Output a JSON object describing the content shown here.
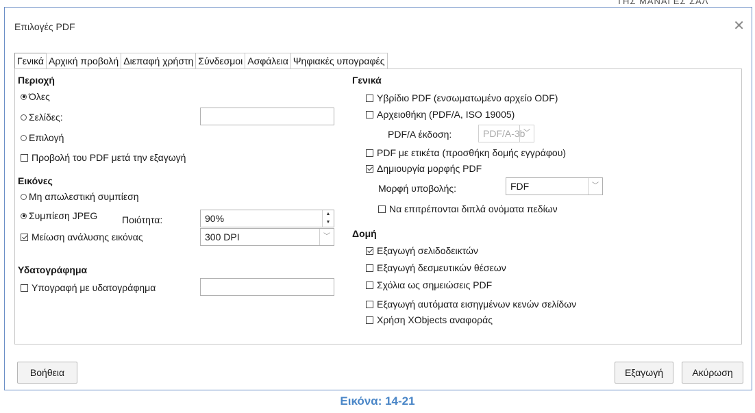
{
  "dialog": {
    "title": "Επιλογές PDF",
    "close": "✕"
  },
  "background_text": "ΤΗΣ ΜΑΝΑΓΕΣ ΣΑΛ",
  "tabs": [
    {
      "label": "Γενικά",
      "active": true
    },
    {
      "label": "Αρχική προβολή"
    },
    {
      "label": "Διεπαφή χρήστη"
    },
    {
      "label": "Σύνδεσμοι"
    },
    {
      "label": "Ασφάλεια"
    },
    {
      "label": "Ψηφιακές υπογραφές"
    }
  ],
  "left": {
    "range_heading": "Περιοχή",
    "all": "Όλες",
    "pages": "Σελίδες:",
    "pages_value": "",
    "selection": "Επιλογή",
    "view_after_export": "Προβολή του PDF μετά την εξαγωγή",
    "images_heading": "Εικόνες",
    "lossless": "Μη απωλεστική συμπίεση",
    "jpeg": "Συμπίεση JPEG",
    "quality_label": "Ποιότητα:",
    "quality_value": "90%",
    "reduce_resolution": "Μείωση ανάλυσης εικόνας",
    "resolution_value": "300 DPI",
    "watermark_heading": "Υδατογράφημα",
    "sign_watermark": "Υπογραφή με υδατογράφημα",
    "watermark_value": ""
  },
  "right": {
    "general_heading": "Γενικά",
    "hybrid_pdf": "Υβρίδιο PDF (ενσωματωμένο αρχείο ODF)",
    "archive": "Αρχειοθήκη (PDF/A, ISO 19005)",
    "pdfa_version_label": "PDF/A έκδοση:",
    "pdfa_version_value": "PDF/A-3b",
    "tagged_pdf": "PDF με ετικέτα (προσθήκη δομής εγγράφου)",
    "create_form": "Δημιουργία μορφής PDF",
    "submit_format_label": "Μορφή υποβολής:",
    "submit_format_value": "FDF",
    "duplicate_names": "Να επιτρέπονται διπλά ονόματα πεδίων",
    "structure_heading": "Δομή",
    "export_bookmarks": "Εξαγωγή σελιδοδεικτών",
    "export_placeholders": "Εξαγωγή δεσμευτικών θέσεων",
    "comments_as_notes": "Σχόλια ως σημειώσεις PDF",
    "export_blank_pages": "Εξαγωγή αυτόματα εισηγμένων κενών σελίδων",
    "use_xobjects": "Χρήση XObjects αναφοράς"
  },
  "buttons": {
    "help": "Βοήθεια",
    "export": "Εξαγωγή",
    "cancel": "Ακύρωση"
  },
  "caption": "Εικόνα: 14-21",
  "state": {
    "range": "all",
    "image_compression": "jpeg",
    "view_after_export": false,
    "reduce_resolution": true,
    "sign_watermark": false,
    "hybrid_pdf": false,
    "archive": false,
    "tagged_pdf": false,
    "create_form": true,
    "duplicate_names": false,
    "export_bookmarks": true,
    "export_placeholders": false,
    "comments_as_notes": false,
    "export_blank_pages": false,
    "use_xobjects": false
  }
}
